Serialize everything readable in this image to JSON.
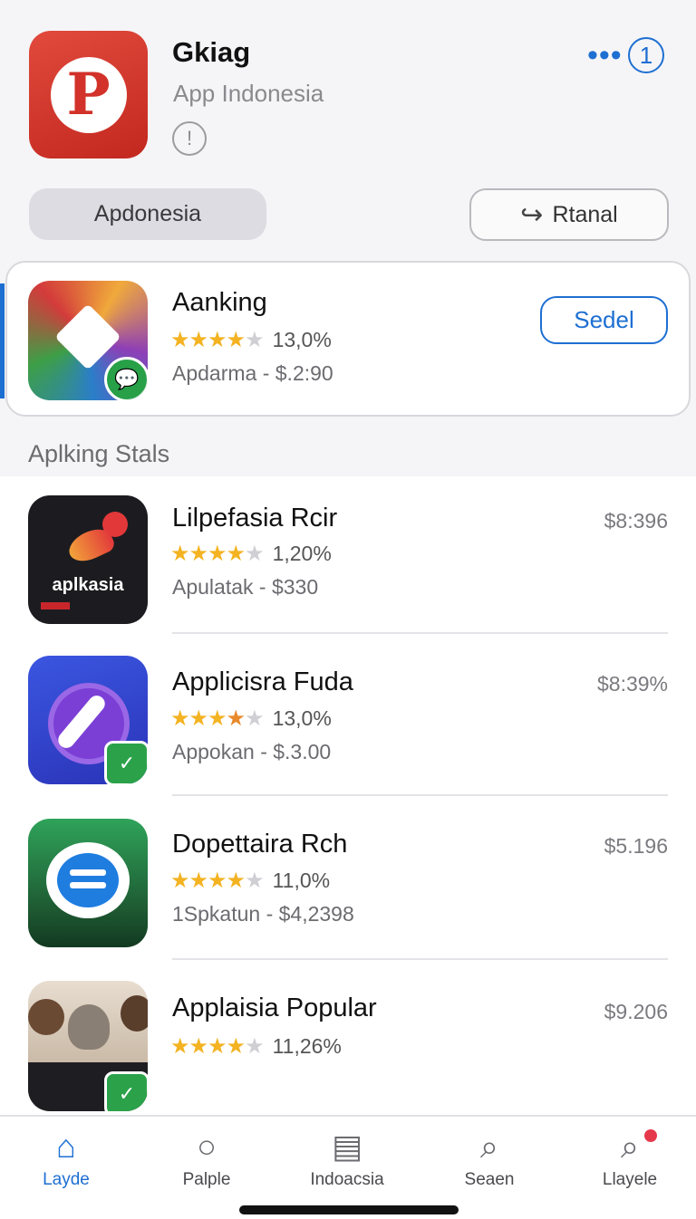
{
  "header": {
    "title": "Gkiag",
    "subtitle": "App Indonesia",
    "info_icon": "info-bubble-icon",
    "more_icon": "ellipsis-icon",
    "badge_number": "1",
    "pill_label": "Apdonesia",
    "share_label": "Rtanal",
    "accent_color": "#1e6fd2"
  },
  "featured": {
    "name": "Aanking",
    "stars": 3.5,
    "rating_text": "13,0%",
    "subtitle": "Apdarma - $.2:90",
    "button_label": "Sedel"
  },
  "section": {
    "title": "Aplking Stals"
  },
  "list": [
    {
      "name": "Lilpefasia Rcir",
      "stars": 4,
      "rating_text": "1,20%",
      "subtitle": "Apulatak - $330",
      "price": "$8:396",
      "icon_text": "aplkasia"
    },
    {
      "name": "Applicisra Fuda",
      "stars": 4,
      "rating_text": "13,0%",
      "subtitle": "Appokan - $.3.00",
      "price": "$8:39%"
    },
    {
      "name": "Dopettaira Rch",
      "stars": 4,
      "rating_text": "11,0%",
      "subtitle": "1Spkatun - $4,2398",
      "price": "$5.196"
    },
    {
      "name": "Applaisia Popular",
      "stars": 4,
      "rating_text": "11,26%",
      "price": "$9.206"
    }
  ],
  "tabs": [
    {
      "label": "Layde",
      "icon": "home-icon",
      "active": true
    },
    {
      "label": "Palple",
      "icon": "drop-icon"
    },
    {
      "label": "Indoacsia",
      "icon": "document-icon"
    },
    {
      "label": "Seaen",
      "icon": "search-icon"
    },
    {
      "label": "Llayele",
      "icon": "search-notification-icon"
    }
  ]
}
